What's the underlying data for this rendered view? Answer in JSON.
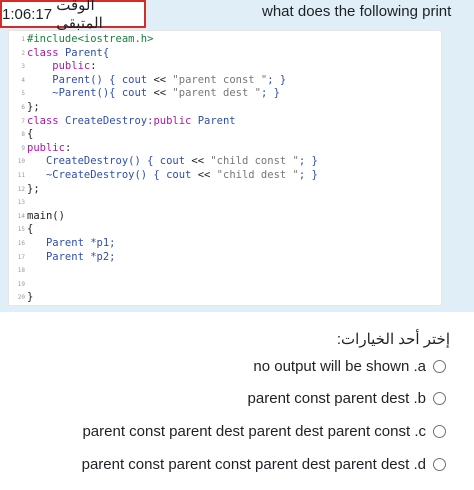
{
  "timer": {
    "label": "الوقت المتبقي",
    "value": "1:06:17"
  },
  "question": {
    "text": "what does the following print"
  },
  "code": {
    "lines": [
      {
        "n": "1",
        "segs": [
          {
            "t": "#include<iostream.h>",
            "c": "pp"
          }
        ]
      },
      {
        "n": "2",
        "segs": [
          {
            "t": "class ",
            "c": "kw"
          },
          {
            "t": "Parent{",
            "c": "id"
          }
        ]
      },
      {
        "n": "3",
        "segs": [
          {
            "t": "    public",
            "c": "kw"
          },
          {
            "t": ":",
            "c": "pn"
          }
        ]
      },
      {
        "n": "4",
        "segs": [
          {
            "t": "    Parent() { ",
            "c": "id"
          },
          {
            "t": "cout",
            "c": "id"
          },
          {
            "t": " << ",
            "c": "pn"
          },
          {
            "t": "\"parent const \"",
            "c": "st"
          },
          {
            "t": "; }",
            "c": "id"
          }
        ]
      },
      {
        "n": "5",
        "segs": [
          {
            "t": "    ~Parent(){ ",
            "c": "id"
          },
          {
            "t": "cout",
            "c": "id"
          },
          {
            "t": " << ",
            "c": "pn"
          },
          {
            "t": "\"parent dest \"",
            "c": "st"
          },
          {
            "t": "; }",
            "c": "id"
          }
        ]
      },
      {
        "n": "6",
        "segs": [
          {
            "t": "};",
            "c": "pn"
          }
        ]
      },
      {
        "n": "7",
        "segs": [
          {
            "t": "class ",
            "c": "kw"
          },
          {
            "t": "CreateDestroy",
            "c": "id"
          },
          {
            "t": ":public ",
            "c": "kw"
          },
          {
            "t": "Parent",
            "c": "id"
          }
        ]
      },
      {
        "n": "8",
        "segs": [
          {
            "t": "{",
            "c": "pn"
          }
        ]
      },
      {
        "n": "9",
        "segs": [
          {
            "t": "public",
            "c": "kw"
          },
          {
            "t": ":",
            "c": "pn"
          }
        ]
      },
      {
        "n": "10",
        "segs": [
          {
            "t": "   CreateDestroy() { ",
            "c": "id"
          },
          {
            "t": "cout",
            "c": "id"
          },
          {
            "t": " << ",
            "c": "pn"
          },
          {
            "t": "\"child const \"",
            "c": "st"
          },
          {
            "t": "; }",
            "c": "id"
          }
        ]
      },
      {
        "n": "11",
        "segs": [
          {
            "t": "   ~CreateDestroy() { ",
            "c": "id"
          },
          {
            "t": "cout",
            "c": "id"
          },
          {
            "t": " << ",
            "c": "pn"
          },
          {
            "t": "\"child dest \"",
            "c": "st"
          },
          {
            "t": "; }",
            "c": "id"
          }
        ]
      },
      {
        "n": "12",
        "segs": [
          {
            "t": "};",
            "c": "pn"
          }
        ]
      },
      {
        "n": "13",
        "segs": []
      },
      {
        "n": "14",
        "segs": [
          {
            "t": "main()",
            "c": "pn"
          }
        ]
      },
      {
        "n": "15",
        "segs": [
          {
            "t": "{",
            "c": "pn"
          }
        ]
      },
      {
        "n": "16",
        "segs": [
          {
            "t": "   Parent *p1;",
            "c": "id"
          }
        ]
      },
      {
        "n": "17",
        "segs": [
          {
            "t": "   Parent *p2;",
            "c": "id"
          }
        ]
      },
      {
        "n": "18",
        "segs": []
      },
      {
        "n": "19",
        "segs": []
      },
      {
        "n": "20",
        "segs": [
          {
            "t": "}",
            "c": "pn"
          }
        ]
      }
    ]
  },
  "answers": {
    "prompt": "إختر أحد الخيارات:",
    "options": [
      {
        "text": "no output will be shown .a"
      },
      {
        "text": "parent const parent dest .b"
      },
      {
        "text": "parent const parent dest parent dest parent const .c"
      },
      {
        "text": "parent const parent const parent dest parent dest .d"
      }
    ]
  }
}
